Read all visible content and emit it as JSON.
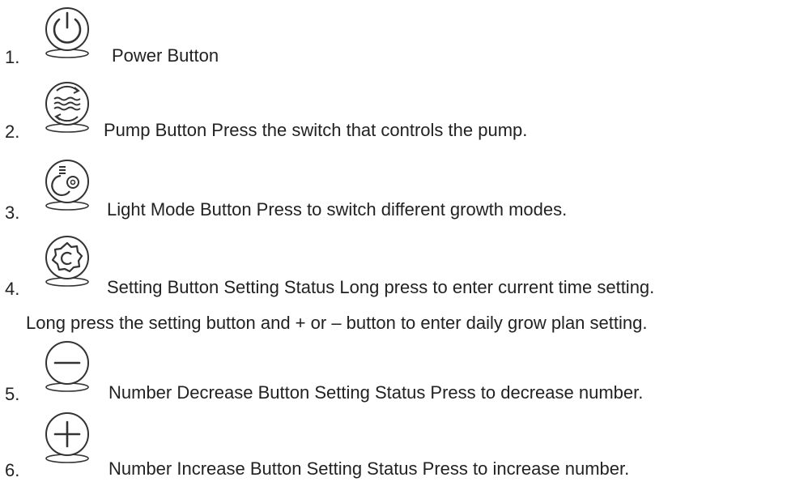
{
  "items": [
    {
      "number": "1.",
      "icon": "power-icon",
      "text": "Power Button"
    },
    {
      "number": "2.",
      "icon": "pump-icon",
      "text": "Pump Button Press the switch that controls the pump."
    },
    {
      "number": "3.",
      "icon": "light-mode-icon",
      "text": "Light Mode Button Press to switch different growth modes."
    },
    {
      "number": "4.",
      "icon": "setting-gear-icon",
      "text": "Setting Button  Setting Status Long press to enter current time setting.",
      "continuation": "Long press the setting button and + or – button to enter daily grow plan setting."
    },
    {
      "number": "5.",
      "icon": "minus-icon",
      "text": "Number Decrease Button  Setting Status Press to decrease number."
    },
    {
      "number": "6.",
      "icon": "plus-icon",
      "text": "Number Increase Button  Setting Status Press to increase number."
    }
  ],
  "colors": {
    "text": "#222222",
    "icon_stroke": "#333333"
  }
}
